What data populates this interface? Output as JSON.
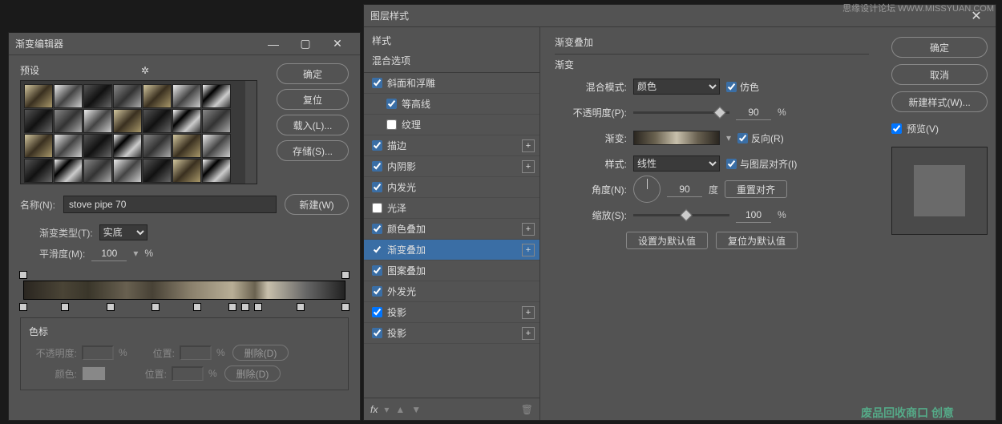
{
  "watermark": {
    "top": "思缘设计论坛  WWW.MISSYUAN.COM",
    "bottom": "废品回收商口 创意"
  },
  "gradientEditor": {
    "title": "渐变编辑器",
    "presetsLabel": "预设",
    "buttons": {
      "ok": "确定",
      "reset": "复位",
      "load": "载入(L)...",
      "save": "存储(S)...",
      "new": "新建(W)"
    },
    "nameLabel": "名称(N):",
    "nameValue": "stove pipe 70",
    "typeLabel": "渐变类型(T):",
    "typeValue": "实底",
    "smoothLabel": "平滑度(M):",
    "smoothValue": "100",
    "pct": "%",
    "stops": {
      "legend": "色标",
      "opacityLabel": "不透明度:",
      "positionLabel": "位置:",
      "colorLabel": "颜色:",
      "delete": "删除(D)"
    }
  },
  "layerStyle": {
    "title": "图层样式",
    "stylesHeader": "样式",
    "blendHeader": "混合选项",
    "items": {
      "bevel": "斜面和浮雕",
      "contour": "等高线",
      "texture": "纹理",
      "stroke": "描边",
      "innerShadow": "内阴影",
      "innerGlow": "内发光",
      "satin": "光泽",
      "colorOverlay": "颜色叠加",
      "gradientOverlay": "渐变叠加",
      "patternOverlay": "图案叠加",
      "outerGlow": "外发光",
      "dropShadow1": "投影",
      "dropShadow2": "投影"
    },
    "fxLabel": "fx",
    "settings": {
      "panelTitle": "渐变叠加",
      "subTitle": "渐变",
      "blendMode": "混合模式:",
      "blendValue": "颜色",
      "dither": "仿色",
      "opacity": "不透明度(P):",
      "opacityValue": "90",
      "gradient": "渐变:",
      "reverse": "反向(R)",
      "style": "样式:",
      "styleValue": "线性",
      "alignLayer": "与图层对齐(I)",
      "angle": "角度(N):",
      "angleValue": "90",
      "degree": "度",
      "resetAlign": "重置对齐",
      "scale": "缩放(S):",
      "scaleValue": "100",
      "pct": "%",
      "setDefault": "设置为默认值",
      "resetDefault": "复位为默认值"
    },
    "rightButtons": {
      "ok": "确定",
      "cancel": "取消",
      "newStyle": "新建样式(W)...",
      "preview": "预览(V)"
    }
  }
}
